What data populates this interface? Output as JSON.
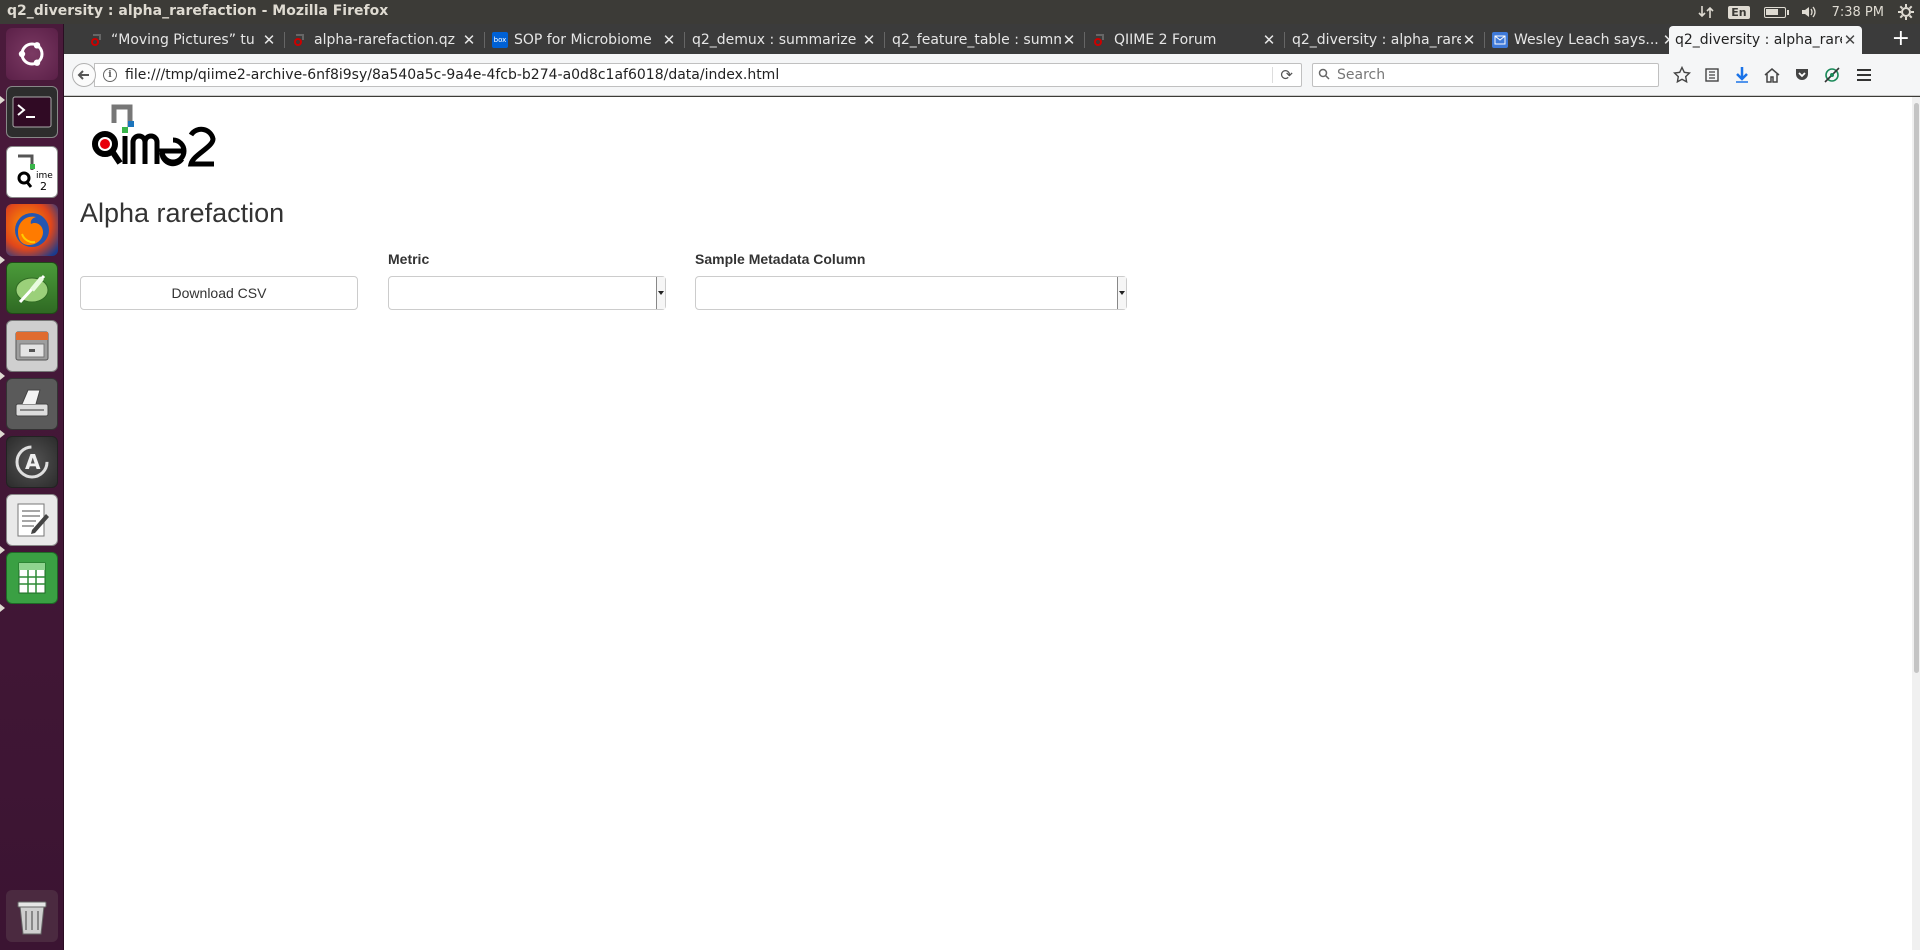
{
  "os": {
    "window_title": "q2_diversity : alpha_rarefaction - Mozilla Firefox",
    "indicators": {
      "network_icon": "network-updown-icon",
      "language": "En",
      "battery_icon": "battery-icon",
      "volume_icon": "volume-icon",
      "clock": "7:38 PM",
      "settings_icon": "gear-icon"
    },
    "launcher": [
      {
        "name": "ubuntu-dash",
        "icon": "ubuntu-logo-icon"
      },
      {
        "name": "terminal",
        "icon": "terminal-icon",
        "glyph": ">_"
      },
      {
        "name": "qiime2-viewer",
        "icon": "qiime2-icon"
      },
      {
        "name": "firefox",
        "icon": "firefox-icon"
      },
      {
        "name": "text-editor-feather",
        "icon": "feather-icon"
      },
      {
        "name": "file-cabinet",
        "icon": "archive-icon"
      },
      {
        "name": "printer-tool",
        "icon": "scanner-icon"
      },
      {
        "name": "software-updater",
        "icon": "updater-icon",
        "glyph": "A"
      },
      {
        "name": "gedit",
        "icon": "text-editor-icon"
      },
      {
        "name": "spreadsheet",
        "icon": "spreadsheet-icon"
      },
      {
        "name": "trash",
        "icon": "trash-icon"
      }
    ]
  },
  "browser": {
    "tabs": [
      {
        "label": "“Moving Pictures” tu",
        "favicon": "qiime-favicon",
        "active": false
      },
      {
        "label": "alpha-rarefaction.qz",
        "favicon": "qiime-favicon",
        "active": false
      },
      {
        "label": "SOP for Microbiome",
        "favicon": "box-favicon",
        "favicon_text": "box",
        "active": false
      },
      {
        "label": "q2_demux : summarize",
        "favicon": "none",
        "active": false
      },
      {
        "label": "q2_feature_table : summ",
        "favicon": "none",
        "active": false
      },
      {
        "label": "QIIME 2 Forum",
        "favicon": "qiime-favicon",
        "active": false
      },
      {
        "label": "q2_diversity : alpha_rare",
        "favicon": "none",
        "active": false
      },
      {
        "label": "Wesley Leach says...",
        "favicon": "mail-favicon",
        "active": false
      },
      {
        "label": "q2_diversity : alpha_rare",
        "favicon": "none",
        "active": true
      }
    ],
    "url": "file:///tmp/qiime2-archive-6nf8i9sy/8a540a5c-9a4e-4fcb-b274-a0d8c1af6018/data/index.html",
    "search_placeholder": "Search"
  },
  "page": {
    "logo_text": "qiime2",
    "title": "Alpha rarefaction",
    "download_button": "Download CSV",
    "metric_label": "Metric",
    "metric_value": "",
    "metadata_label": "Sample Metadata Column",
    "metadata_value": ""
  },
  "colors": {
    "launcher_bg": "#4a1a3b",
    "tab_active_bg": "#f5f6f7",
    "logo_red": "#e8000b",
    "logo_green": "#39b54a",
    "logo_blue": "#1c75bc"
  }
}
